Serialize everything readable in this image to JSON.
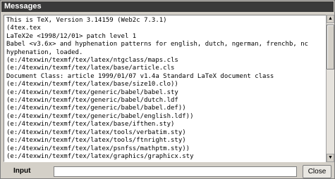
{
  "window": {
    "title": "Messages"
  },
  "log": {
    "lines": [
      "This is TeX, Version 3.14159 (Web2c 7.3.1)",
      "(4tex.tex",
      "LaTeX2e <1998/12/01> patch level 1",
      "Babel <v3.6x> and hyphenation patterns for english, dutch, ngerman, frenchb, nc",
      "hyphenation, loaded.",
      "(e:/4texwin/texmf/tex/latex/ntgclass/maps.cls",
      "(e:/4texwin/texmf/tex/latex/base/article.cls",
      "Document Class: article 1999/01/07 v1.4a Standard LaTeX document class",
      "(e:/4texwin/texmf/tex/latex/base/size10.clo))",
      "(e:/4texwin/texmf/tex/generic/babel/babel.sty",
      "(e:/4texwin/texmf/tex/generic/babel/dutch.ldf",
      "(e:/4texwin/texmf/tex/generic/babel/babel.def))",
      "(e:/4texwin/texmf/tex/generic/babel/english.ldf))",
      "(e:/4texwin/texmf/tex/latex/base/ifthen.sty)",
      "(e:/4texwin/texmf/tex/latex/tools/verbatim.sty)",
      "(e:/4texwin/texmf/tex/latex/tools/ftnright.sty)",
      "(e:/4texwin/texmf/tex/latex/psnfss/mathptm.sty))",
      "(e:/4texwin/texmf/tex/latex/graphics/graphicx.sty"
    ]
  },
  "scrollbar": {
    "up_glyph": "▲",
    "down_glyph": "▼"
  },
  "input": {
    "label": "Input",
    "value": ""
  },
  "close_button": {
    "label": "Close"
  }
}
